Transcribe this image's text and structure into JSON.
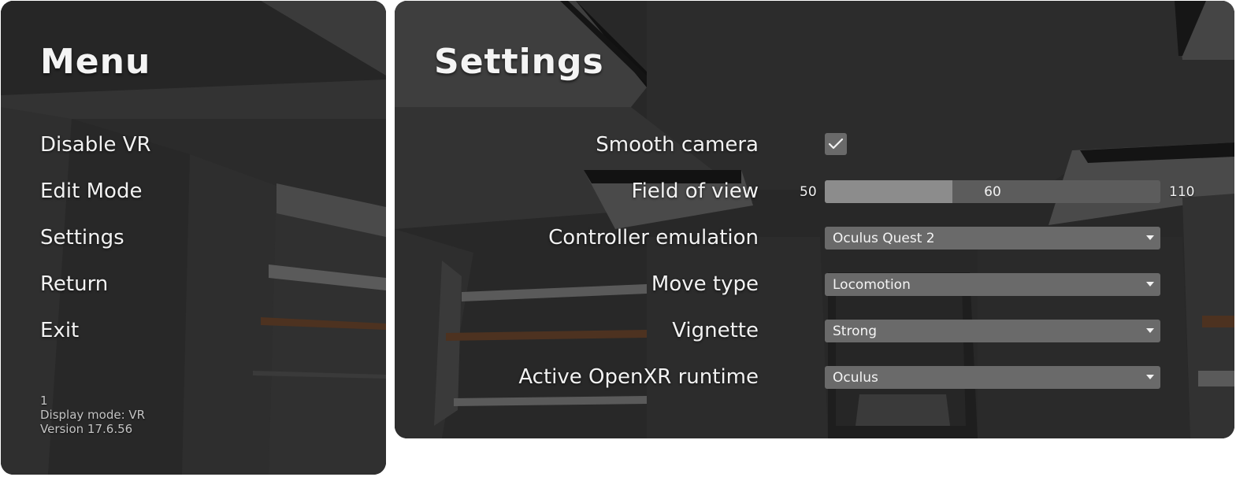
{
  "menu": {
    "title": "Menu",
    "items": [
      {
        "label": "Disable VR"
      },
      {
        "label": "Edit Mode"
      },
      {
        "label": "Settings"
      },
      {
        "label": "Return"
      },
      {
        "label": "Exit"
      }
    ],
    "footer": {
      "line1": "1",
      "display_mode": "Display mode: VR",
      "version": "Version 17.6.56"
    }
  },
  "settings": {
    "title": "Settings",
    "smooth_camera": {
      "label": "Smooth camera",
      "checked": true
    },
    "field_of_view": {
      "label": "Field of view",
      "min": "50",
      "max": "110",
      "value": "60",
      "fill_fraction": 0.38
    },
    "controller_emulation": {
      "label": "Controller emulation",
      "value": "Oculus Quest 2"
    },
    "move_type": {
      "label": "Move type",
      "value": "Locomotion"
    },
    "vignette": {
      "label": "Vignette",
      "value": "Strong"
    },
    "openxr_runtime": {
      "label": "Active OpenXR runtime",
      "value": "Oculus"
    }
  },
  "icons": {
    "checkmark": "check-icon",
    "dropdown": "chevron-down-icon"
  },
  "colors": {
    "control_bg": "#6a6a6a",
    "slider_track": "#5c5c5c",
    "slider_fill": "#8c8c8c",
    "text": "#f2f2f2"
  }
}
